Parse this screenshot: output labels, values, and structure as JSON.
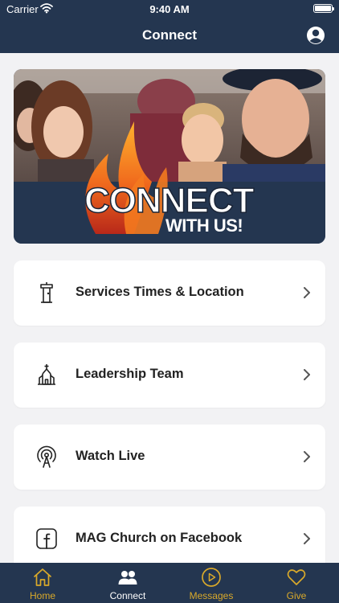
{
  "status_bar": {
    "carrier": "Carrier",
    "time": "9:40 AM"
  },
  "header": {
    "title": "Connect"
  },
  "hero": {
    "line1": "CONNECT",
    "line2": "WITH US!"
  },
  "menu": [
    {
      "label": "Services Times & Location",
      "icon": "pulpit-icon"
    },
    {
      "label": "Leadership Team",
      "icon": "church-icon"
    },
    {
      "label": "Watch Live",
      "icon": "broadcast-icon"
    },
    {
      "label": "MAG Church on Facebook",
      "icon": "facebook-icon"
    }
  ],
  "tabs": [
    {
      "label": "Home",
      "icon": "home-icon",
      "active": false
    },
    {
      "label": "Connect",
      "icon": "people-icon",
      "active": true
    },
    {
      "label": "Messages",
      "icon": "play-icon",
      "active": false
    },
    {
      "label": "Give",
      "icon": "heart-icon",
      "active": false
    }
  ],
  "colors": {
    "navy": "#243650",
    "accent": "#d9a92a",
    "background": "#f2f2f4",
    "card": "#ffffff"
  }
}
